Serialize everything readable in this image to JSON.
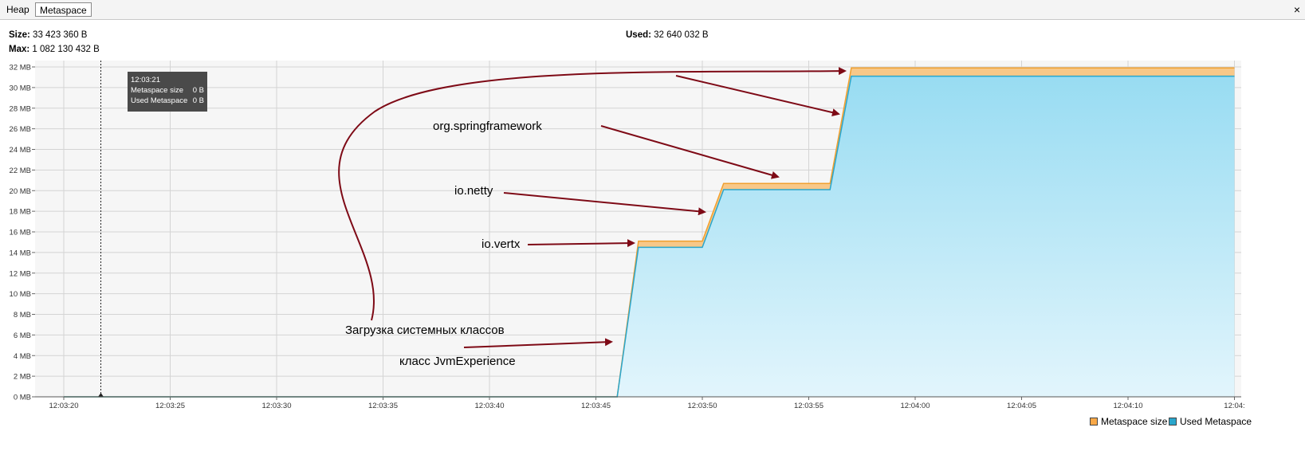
{
  "tabs": {
    "heap": "Heap",
    "metaspace": "Metaspace",
    "close": "×"
  },
  "info": {
    "size_label": "Size:",
    "size_value": "33 423 360 B",
    "max_label": "Max:",
    "max_value": "1 082 130 432 B",
    "used_label": "Used:",
    "used_value": "32 640 032 B"
  },
  "tooltip": {
    "time": "12:03:21",
    "rows": [
      {
        "label": "Metaspace size",
        "value": "0 B"
      },
      {
        "label": "Used Metaspace",
        "value": "0 B"
      }
    ]
  },
  "annotations": {
    "spring": "org.springframework",
    "netty": "io.netty",
    "vertx": "io.vertx",
    "system": "Загрузка системных классов",
    "jvm": "класс JvmExperience"
  },
  "legend": {
    "size": "Metaspace size",
    "used": "Used Metaspace"
  },
  "colors": {
    "size_line": "#f0a030",
    "size_fill": "#f8c888",
    "used_line": "#2aa6cc",
    "used_fill": "#9fe0f4",
    "arrow": "#7e0a16",
    "plot_bg": "#f6f6f6",
    "grid": "#d4d4d4"
  },
  "chart_data": {
    "type": "area",
    "y_unit": "MB",
    "ylim": [
      0,
      32
    ],
    "y_ticks": [
      "0 MB",
      "2 MB",
      "4 MB",
      "6 MB",
      "8 MB",
      "10 MB",
      "12 MB",
      "14 MB",
      "16 MB",
      "18 MB",
      "20 MB",
      "22 MB",
      "24 MB",
      "26 MB",
      "28 MB",
      "30 MB",
      "32 MB"
    ],
    "x_ticks": [
      "12:03:20",
      "12:03:25",
      "12:03:30",
      "12:03:35",
      "12:03:40",
      "12:03:45",
      "12:03:50",
      "12:03:55",
      "12:04:00",
      "12:04:05",
      "12:04:10",
      "12:04:"
    ],
    "cursor_time": "12:03:21",
    "series": [
      {
        "name": "Metaspace size",
        "t": [
          "12:03:20",
          "12:03:46",
          "12:03:47",
          "12:03:50",
          "12:03:51",
          "12:03:56",
          "12:03:57",
          "12:04:15"
        ],
        "values": [
          0,
          0,
          15.1,
          15.1,
          20.7,
          20.7,
          31.9,
          31.9
        ]
      },
      {
        "name": "Used Metaspace",
        "t": [
          "12:03:20",
          "12:03:46",
          "12:03:47",
          "12:03:50",
          "12:03:51",
          "12:03:56",
          "12:03:57",
          "12:04:15"
        ],
        "values": [
          0,
          0,
          14.5,
          14.5,
          20.1,
          20.1,
          31.1,
          31.1
        ]
      }
    ]
  }
}
